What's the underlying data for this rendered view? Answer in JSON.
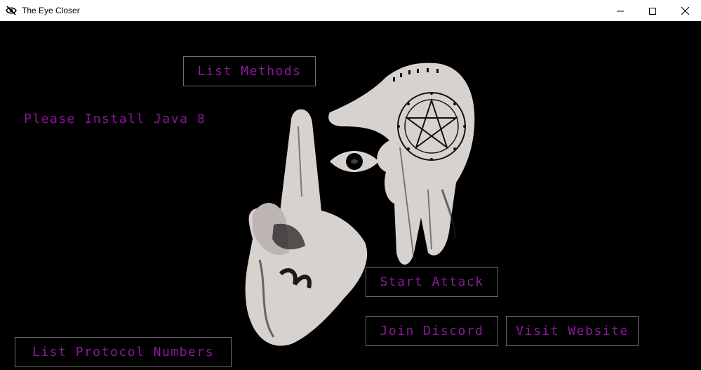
{
  "window": {
    "title": "The Eye Closer",
    "icon": "eye-slash-icon"
  },
  "controls": {
    "minimize_icon": "minimize-icon",
    "maximize_icon": "maximize-icon",
    "close_icon": "close-icon"
  },
  "buttons": {
    "list_methods": "List Methods",
    "start_attack": "Start Attack",
    "join_discord": "Join Discord",
    "visit_website": "Visit Website",
    "list_protocol_numbers": "List Protocol Numbers"
  },
  "status": {
    "message": "Please Install Java 8"
  },
  "image": {
    "description_icon": "hands-eye-pentagram-artwork"
  },
  "colors": {
    "background": "#000000",
    "accent_text": "#8a1a9a",
    "button_border": "#6e6e6e",
    "artwork": "#d8d2cf"
  }
}
